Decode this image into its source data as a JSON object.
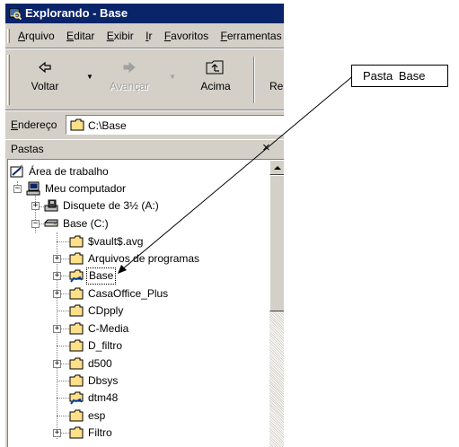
{
  "window": {
    "title": "Explorando - Base"
  },
  "menu": [
    "Arquivo",
    "Editar",
    "Exibir",
    "Ir",
    "Favoritos",
    "Ferramentas"
  ],
  "toolbar": {
    "back_label": "Voltar",
    "forward_label": "Avançar",
    "up_label": "Acima",
    "next_label": "Re"
  },
  "address": {
    "label": "Endereço",
    "value": "C:\\Base"
  },
  "folders_pane": {
    "title": "Pastas",
    "close_symbol": "×"
  },
  "tree": {
    "desktop": "Área de trabalho",
    "computer": "Meu computador",
    "floppy": "Disquete de 3½ (A:)",
    "drive": "Base (C:)",
    "folders": [
      "$vault$.avg",
      "Arquivos de programas",
      "Base",
      "CasaOffice_Plus",
      "CDpply",
      "C-Media",
      "D_filtro",
      "d500",
      "Dbsys",
      "dtm48",
      "esp",
      "Filtro"
    ],
    "selected": "Base"
  },
  "annotation": {
    "label": "Pasta Base"
  },
  "colors": {
    "titlebar": "#0a246a",
    "face": "#d4d0c8",
    "folder": "#ffe08a"
  }
}
